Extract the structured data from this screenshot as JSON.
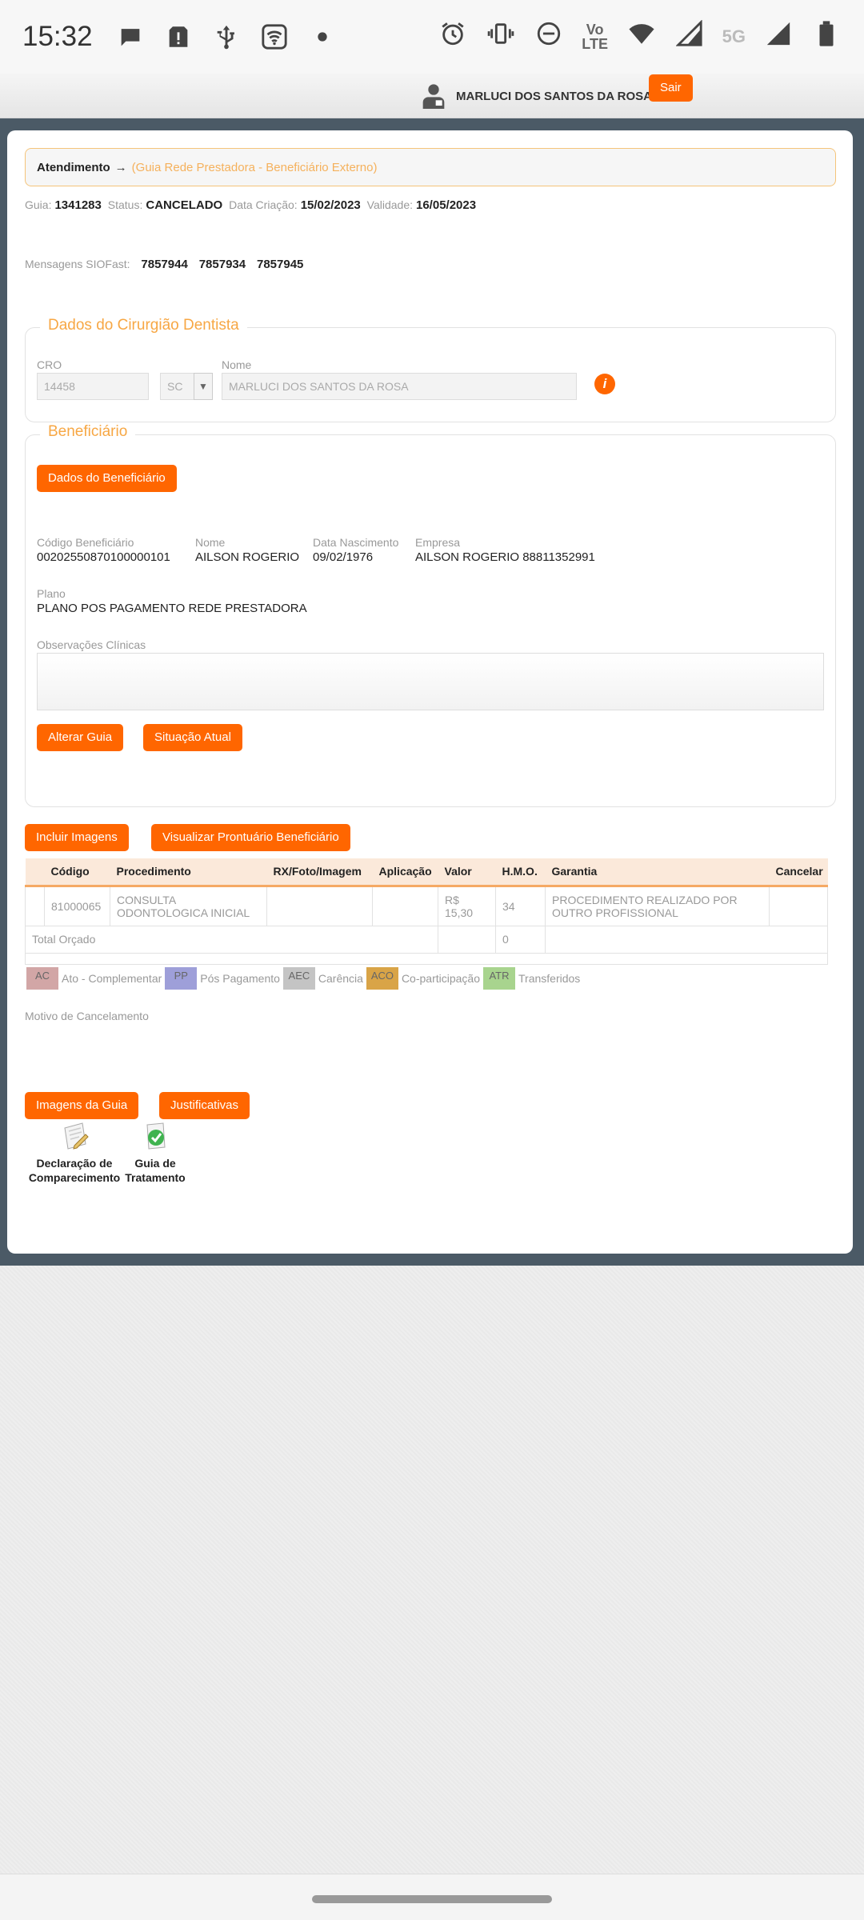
{
  "status_bar": {
    "time": "15:32",
    "left_icons": [
      "chat-bubble-icon",
      "sd-alert-icon",
      "usb-icon",
      "wifi-hotspot-icon",
      "dot-icon"
    ],
    "right_icons": [
      "alarm-icon",
      "vibrate-icon",
      "do-not-disturb-icon",
      "volte-icon",
      "wifi-icon",
      "signal-icon",
      "5g-signal-icon",
      "battery-icon"
    ],
    "volte_text": "Vo LTE",
    "five_g": "5G"
  },
  "header": {
    "user_name": "MARLUCI DOS SANTOS DA ROSA",
    "logout_label": "Sair"
  },
  "breadcrumb": {
    "root": "Atendimento",
    "arrow": "→",
    "current": "(Guia Rede Prestadora - Beneficiário Externo)"
  },
  "guia_info": {
    "guia_label": "Guia:",
    "guia_value": "1341283",
    "status_label": "Status:",
    "status_value": "CANCELADO",
    "criacao_label": "Data Criação:",
    "criacao_value": "15/02/2023",
    "validade_label": "Validade:",
    "validade_value": "16/05/2023"
  },
  "mensagens": {
    "label": "Mensagens SIOFast:",
    "values": [
      "7857944",
      "7857934",
      "7857945"
    ]
  },
  "dentista": {
    "legend": "Dados do Cirurgião Dentista",
    "cro_label": "CRO",
    "cro_value": "14458",
    "uf_value": "SC",
    "nome_label": "Nome",
    "nome_value": "MARLUCI DOS SANTOS DA ROSA"
  },
  "beneficiario": {
    "legend": "Beneficiário",
    "dados_button": "Dados do Beneficiário",
    "codigo_label": "Código Beneficiário",
    "codigo_value": "00202550870100000101",
    "nome_label": "Nome",
    "nome_value": "AILSON ROGERIO",
    "nasc_label": "Data Nascimento",
    "nasc_value": "09/02/1976",
    "empresa_label": "Empresa",
    "empresa_value": "AILSON ROGERIO 88811352991",
    "plano_label": "Plano",
    "plano_value": "PLANO POS PAGAMENTO REDE PRESTADORA",
    "obs_label": "Observações Clínicas",
    "obs_value": "",
    "alterar_button": "Alterar Guia",
    "situacao_button": "Situação Atual"
  },
  "actions": {
    "incluir_imagens": "Incluir Imagens",
    "visualizar_prontuario": "Visualizar Prontuário Beneficiário"
  },
  "table": {
    "headers": [
      "Código",
      "Procedimento",
      "RX/Foto/Imagem",
      "Aplicação",
      "Valor",
      "H.M.O.",
      "Garantia",
      "Cancelar"
    ],
    "rows": [
      {
        "codigo": "81000065",
        "procedimento": "CONSULTA ODONTOLOGICA INICIAL",
        "rx": "",
        "aplicacao": "",
        "valor": "R$ 15,30",
        "hmo": "34",
        "garantia": "PROCEDIMENTO REALIZADO POR OUTRO PROFISSIONAL",
        "cancelar": ""
      }
    ],
    "total_label": "Total Orçado",
    "total_hmo": "0"
  },
  "legend": [
    {
      "code": "AC",
      "label": "Ato - Complementar",
      "color": "#d2a6a6"
    },
    {
      "code": "PP",
      "label": "Pós Pagamento",
      "color": "#9e9fd9"
    },
    {
      "code": "AEC",
      "label": "Carência",
      "color": "#c4c4c4"
    },
    {
      "code": "ACO",
      "label": "Co-participação",
      "color": "#d9a447"
    },
    {
      "code": "ATR",
      "label": "Transferidos",
      "color": "#a8d48e"
    }
  ],
  "cancelamento": {
    "label": "Motivo de Cancelamento"
  },
  "bottom_buttons": {
    "imagens_guia": "Imagens da Guia",
    "justificativas": "Justificativas"
  },
  "documents": [
    {
      "icon": "pencil-document-icon",
      "line1": "Declaração de",
      "line2": "Comparecimento"
    },
    {
      "icon": "green-check-document-icon",
      "line1": "Guia de",
      "line2": "Tratamento"
    }
  ],
  "colors": {
    "accent": "#ff6600",
    "legend_orange": "#f7a744",
    "frame": "#4b5a66"
  }
}
